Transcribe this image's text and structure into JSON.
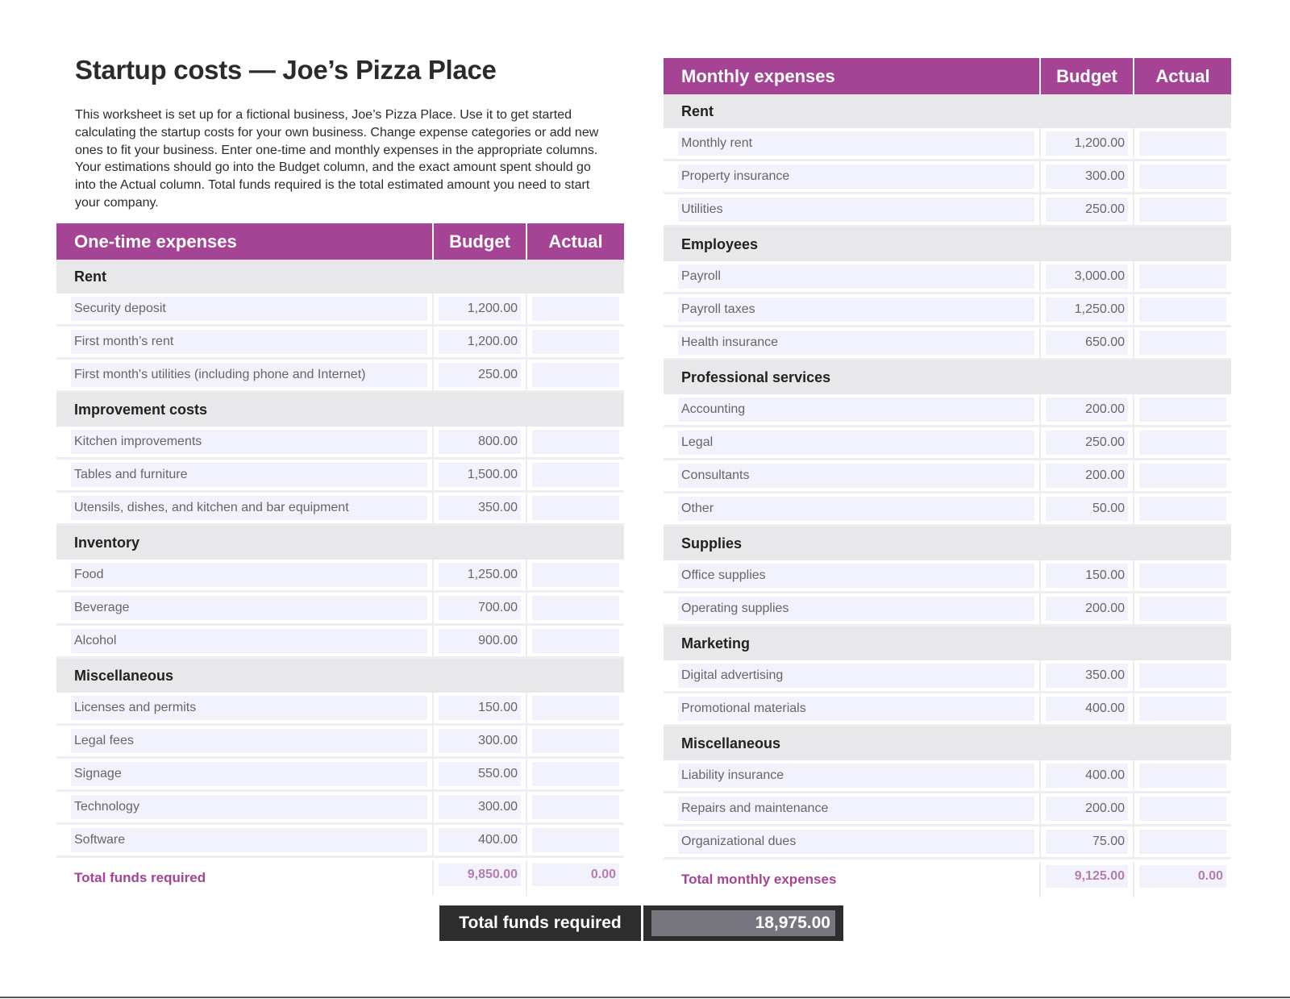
{
  "page": {
    "title": "Startup costs — Joe’s Pizza Place",
    "intro": "This worksheet is set up for a fictional business, Joe’s Pizza Place. Use it to get started calculating the startup costs for your own business. Change expense categories or add new ones to fit your business. Enter one-time and monthly expenses in the appropriate columns. Your estimations should go into the Budget column, and the exact amount spent should go into the Actual column. Total funds required is the total estimated amount you need to start your company."
  },
  "colors": {
    "accent": "#a54395",
    "category_bg": "#e8e8ea",
    "cell_bg": "#f2f2fd",
    "grand_total_bg": "#2d2d2d"
  },
  "one_time": {
    "header": {
      "name": "One-time expenses",
      "budget": "Budget",
      "actual": "Actual"
    },
    "categories": [
      {
        "name": "Rent",
        "items": [
          {
            "label": "Security deposit",
            "budget": "1,200.00",
            "actual": ""
          },
          {
            "label": "First month’s rent",
            "budget": "1,200.00",
            "actual": ""
          },
          {
            "label": "First month's utilities (including phone and Internet)",
            "budget": "250.00",
            "actual": ""
          }
        ]
      },
      {
        "name": "Improvement costs",
        "items": [
          {
            "label": "Kitchen improvements",
            "budget": "800.00",
            "actual": ""
          },
          {
            "label": "Tables and furniture",
            "budget": "1,500.00",
            "actual": ""
          },
          {
            "label": "Utensils, dishes, and kitchen and bar equipment",
            "budget": "350.00",
            "actual": ""
          }
        ]
      },
      {
        "name": "Inventory",
        "items": [
          {
            "label": "Food",
            "budget": "1,250.00",
            "actual": ""
          },
          {
            "label": "Beverage",
            "budget": "700.00",
            "actual": ""
          },
          {
            "label": "Alcohol",
            "budget": "900.00",
            "actual": ""
          }
        ]
      },
      {
        "name": "Miscellaneous",
        "items": [
          {
            "label": "Licenses and permits",
            "budget": "150.00",
            "actual": ""
          },
          {
            "label": "Legal fees",
            "budget": "300.00",
            "actual": ""
          },
          {
            "label": "Signage",
            "budget": "550.00",
            "actual": ""
          },
          {
            "label": "Technology",
            "budget": "300.00",
            "actual": ""
          },
          {
            "label": "Software",
            "budget": "400.00",
            "actual": ""
          }
        ]
      }
    ],
    "total": {
      "label": "Total funds required",
      "budget": "9,850.00",
      "actual": "0.00"
    }
  },
  "monthly": {
    "header": {
      "name": "Monthly expenses",
      "budget": "Budget",
      "actual": "Actual"
    },
    "categories": [
      {
        "name": "Rent",
        "items": [
          {
            "label": "Monthly rent",
            "budget": "1,200.00",
            "actual": ""
          },
          {
            "label": "Property insurance",
            "budget": "300.00",
            "actual": ""
          },
          {
            "label": "Utilities",
            "budget": "250.00",
            "actual": ""
          }
        ]
      },
      {
        "name": "Employees",
        "items": [
          {
            "label": "Payroll",
            "budget": "3,000.00",
            "actual": ""
          },
          {
            "label": "Payroll taxes",
            "budget": "1,250.00",
            "actual": ""
          },
          {
            "label": "Health insurance",
            "budget": "650.00",
            "actual": ""
          }
        ]
      },
      {
        "name": "Professional services",
        "items": [
          {
            "label": "Accounting",
            "budget": "200.00",
            "actual": ""
          },
          {
            "label": "Legal",
            "budget": "250.00",
            "actual": ""
          },
          {
            "label": "Consultants",
            "budget": "200.00",
            "actual": ""
          },
          {
            "label": "Other",
            "budget": "50.00",
            "actual": ""
          }
        ]
      },
      {
        "name": "Supplies",
        "items": [
          {
            "label": "Office supplies",
            "budget": "150.00",
            "actual": ""
          },
          {
            "label": "Operating supplies",
            "budget": "200.00",
            "actual": ""
          }
        ]
      },
      {
        "name": "Marketing",
        "items": [
          {
            "label": "Digital advertising",
            "budget": "350.00",
            "actual": ""
          },
          {
            "label": "Promotional materials",
            "budget": "400.00",
            "actual": ""
          }
        ]
      },
      {
        "name": "Miscellaneous",
        "items": [
          {
            "label": "Liability insurance",
            "budget": "400.00",
            "actual": ""
          },
          {
            "label": "Repairs and maintenance",
            "budget": "200.00",
            "actual": ""
          },
          {
            "label": "Organizational dues",
            "budget": "75.00",
            "actual": ""
          }
        ]
      }
    ],
    "total": {
      "label": "Total monthly expenses",
      "budget": "9,125.00",
      "actual": "0.00"
    }
  },
  "grand_total": {
    "label": "Total funds required",
    "value": "18,975.00"
  }
}
